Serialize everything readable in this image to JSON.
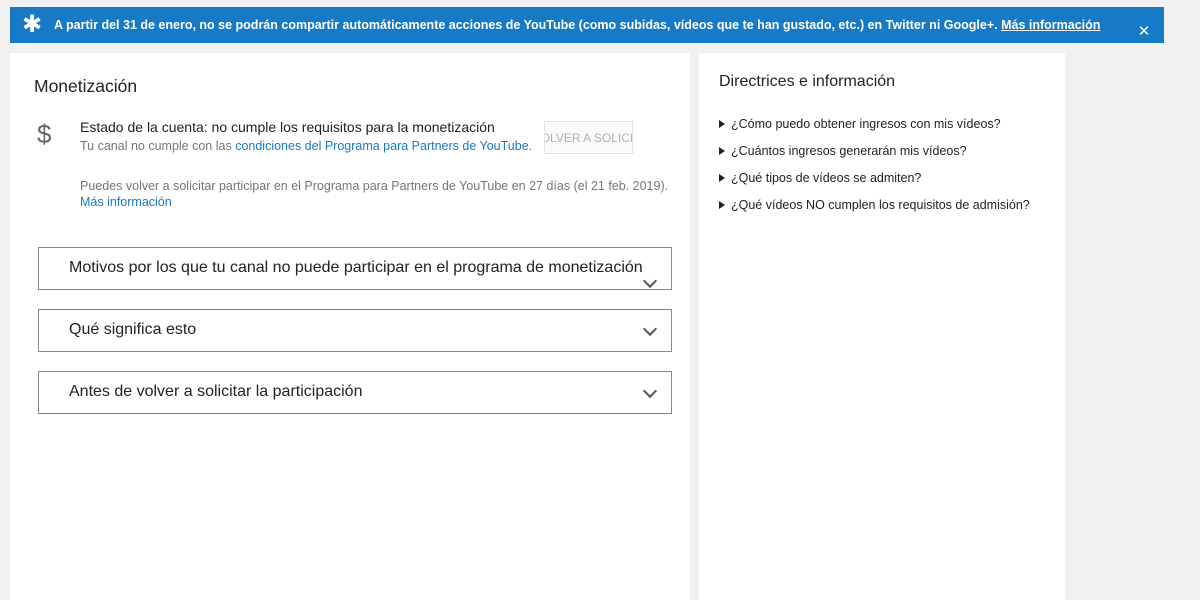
{
  "banner": {
    "message": "A partir del 31 de enero, no se podrán compartir automáticamente acciones de YouTube (como subidas, vídeos que te han gustado, etc.) en Twitter ni Google+. ",
    "more_link": "Más información",
    "star": "✱",
    "close": "✕",
    "color": "#167ac6"
  },
  "monetization": {
    "title": "Monetización",
    "currency_icon": "$",
    "status_title": "Estado de la cuenta: no cumple los requisitos para la monetización",
    "status_sub_prefix": "Tu canal no cumple con las ",
    "status_sub_link": "condiciones del Programa para Partners de YouTube.",
    "reapply_button": "Volver a solicitar",
    "reapply_note": "Puedes volver a solicitar participar en el Programa para Partners de YouTube en 27 días (el 21 feb. 2019).",
    "reapply_more": "Más información",
    "link_color": "#167ac6"
  },
  "accordions": [
    {
      "label": "Motivos por los que tu canal no puede participar en el programa de monetización"
    },
    {
      "label": "Qué significa esto"
    },
    {
      "label": "Antes de volver a solicitar la participación"
    }
  ],
  "sidebar": {
    "title": "Directrices e información",
    "items": [
      {
        "label": "¿Cómo puedo obtener ingresos con mis vídeos?"
      },
      {
        "label": "¿Cuántos ingresos generarán mis vídeos?"
      },
      {
        "label": "¿Qué tipos de vídeos se admiten?"
      },
      {
        "label": "¿Qué vídeos NO cumplen los requisitos de admisión?"
      }
    ]
  }
}
